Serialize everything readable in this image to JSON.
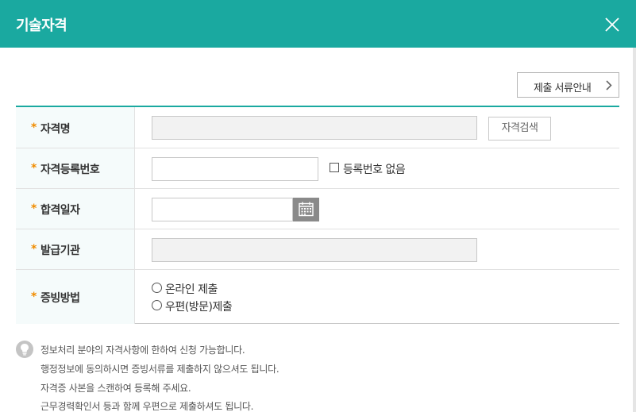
{
  "header": {
    "title": "기술자격"
  },
  "toolbar": {
    "guide_label": "제출 서류안내"
  },
  "form": {
    "rows": [
      {
        "required": "*",
        "label": "자격명",
        "value": "",
        "search_label": "자격검색"
      },
      {
        "required": "*",
        "label": "자격등록번호",
        "value": "",
        "no_number_label": "등록번호 없음"
      },
      {
        "required": "*",
        "label": "합격일자",
        "value": ""
      },
      {
        "required": "*",
        "label": "발급기관",
        "value": ""
      },
      {
        "required": "*",
        "label": "증빙방법",
        "options": [
          "온라인 제출",
          "우편(방문)제출"
        ]
      }
    ]
  },
  "notes": [
    "정보처리 분야의 자격사항에 한하여 신청 가능합니다.",
    "행정정보에 동의하시면 증빙서류를 제출하지 않으셔도 됩니다.",
    "자격증 사본을 스캔하여 등록해 주세요.",
    "근무경력확인서 등과 함께 우편으로 제출하셔도 됩니다."
  ],
  "colors": {
    "accent": "#1aa9a0",
    "required": "#f08c00"
  }
}
